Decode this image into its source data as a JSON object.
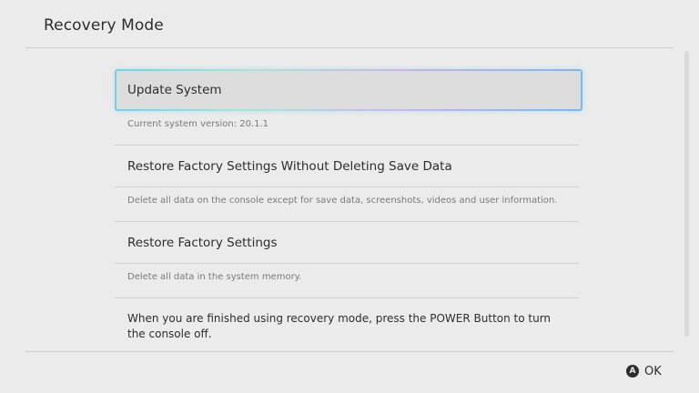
{
  "header": {
    "title": "Recovery Mode"
  },
  "menu": {
    "items": [
      {
        "label": "Update System",
        "description": "Current system version: 20.1.1"
      },
      {
        "label": "Restore Factory Settings Without Deleting Save Data",
        "description": "Delete all data on the console except for save data, screenshots, videos and user information."
      },
      {
        "label": "Restore Factory Settings",
        "description": "Delete all data in the system memory."
      }
    ]
  },
  "note": {
    "text": "When you are finished using recovery mode, press the POWER Button to turn the console off."
  },
  "footer": {
    "button_glyph": "A",
    "ok_label": "OK"
  },
  "colors": {
    "background": "#ebebeb",
    "selected_background": "#dcdcdc",
    "highlight_cyan": "#6fd3e8",
    "highlight_purple": "#c8b6ec",
    "text": "#2d2d2d",
    "muted_text": "#7a7a7a"
  }
}
